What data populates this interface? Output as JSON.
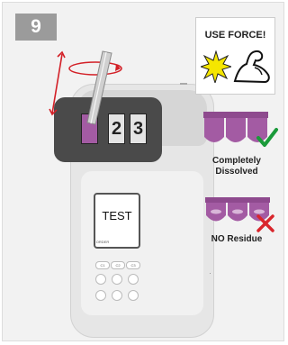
{
  "step": {
    "number": "9"
  },
  "tester": {
    "slot_labels": [
      "",
      "2",
      "3"
    ]
  },
  "device": {
    "screen_text": "TEST",
    "screen_softkeys": [
      "ORDER",
      "",
      ""
    ],
    "row_buttons": [
      "C1",
      "C2",
      "C3"
    ],
    "round_buttons": [
      "",
      "",
      "",
      "",
      "",
      ""
    ]
  },
  "callout": {
    "force_label": "USE FORCE!"
  },
  "status": {
    "dissolved_line1": "Completely",
    "dissolved_line2": "Dissolved",
    "residue_label": "NO Residue"
  },
  "colors": {
    "tablet_purple": "#a35ba3",
    "check_green": "#1a9a3a",
    "cross_red": "#d9262c",
    "motion_red": "#d32027"
  }
}
